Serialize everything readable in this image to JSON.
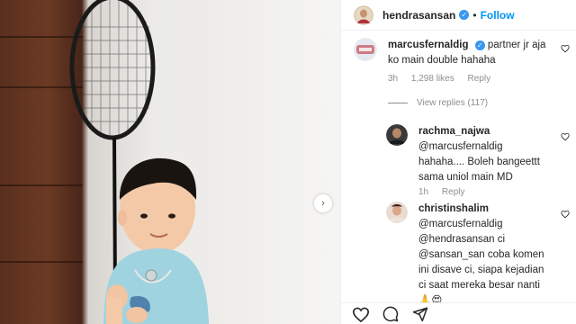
{
  "post": {
    "author": "hendrasansan",
    "follow_label": "Follow",
    "separator": "•"
  },
  "photo": {
    "next_icon": "chevron-right-icon"
  },
  "comments": [
    {
      "user": "marcusfernaldig",
      "verified": true,
      "text": "partner jr aja ko main double hahaha",
      "time": "3h",
      "likes": "1,298 likes",
      "reply_label": "Reply",
      "view_replies": "View replies (117)"
    }
  ],
  "replies": [
    {
      "user": "rachma_najwa",
      "text": "@marcusfernaldig hahaha.... Boleh bangeettt sama uniol main MD",
      "time": "1h",
      "reply_label": "Reply"
    },
    {
      "user": "christinshalim",
      "text": "@marcusfernaldig @hendrasansan ci @sansan_san coba komen ini disave ci, siapa kejadian ci saat mereka besar nanti",
      "emoji": "🙏😍"
    }
  ],
  "actions": {
    "icons": [
      "heart-icon",
      "comment-icon",
      "share-icon"
    ]
  },
  "colors": {
    "link_blue": "#0095f6",
    "verified_blue": "#3897f0",
    "muted": "#8e8e8e"
  }
}
